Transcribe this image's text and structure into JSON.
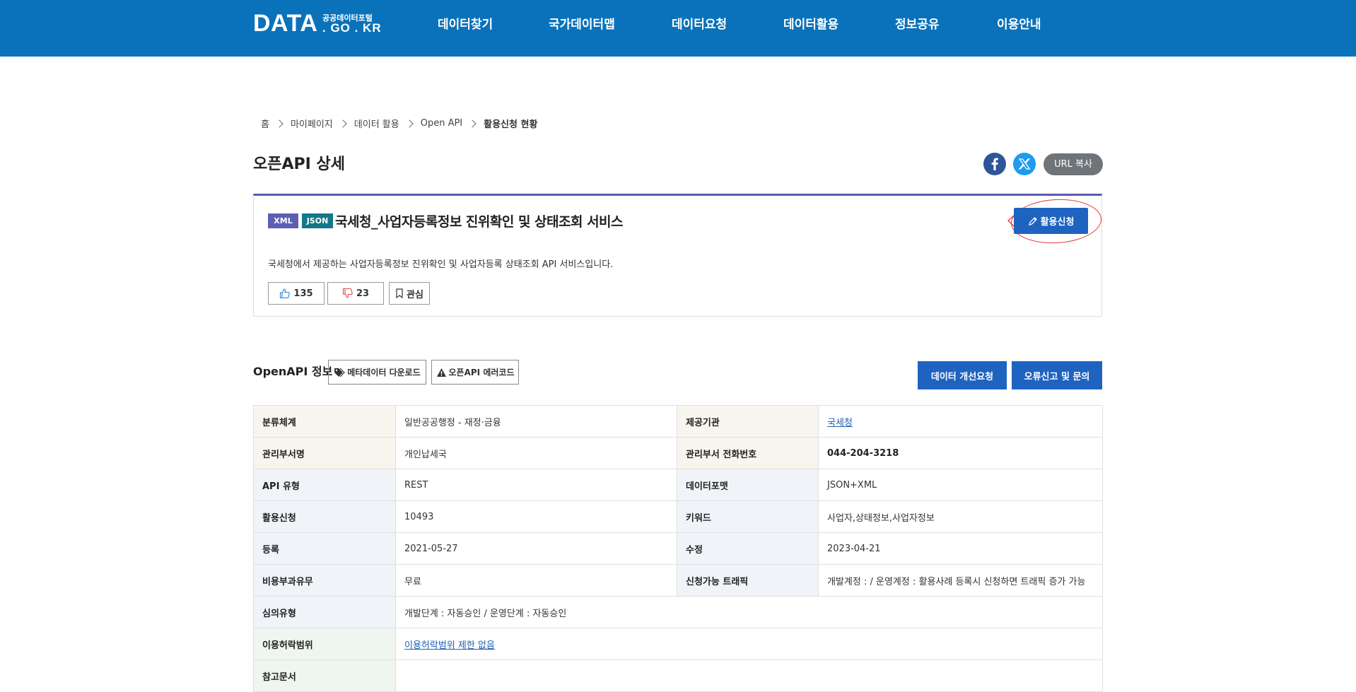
{
  "header": {
    "logo_main": "DATA",
    "logo_sub": "공공데이터포털",
    "logo_domain": ". GO . KR",
    "nav": [
      "데이터찾기",
      "국가데이터맵",
      "데이터요청",
      "데이터활용",
      "정보공유",
      "이용안내"
    ]
  },
  "breadcrumb": [
    "홈",
    "마이페이지",
    "데이터 활용",
    "Open API",
    "활용신청 현황"
  ],
  "page_title": "오픈API 상세",
  "share": {
    "url_copy": "URL 복사",
    "facebook_icon": "facebook-icon",
    "x_icon": "x-twitter-icon"
  },
  "api": {
    "formats": [
      "XML",
      "JSON"
    ],
    "title": "국세청_사업자등록정보 진위확인 및 상태조회 서비스",
    "apply_label": "활용신청",
    "description": "국세청에서 제공하는 사업자등록정보 진위확인 및 사업자등록 상태조회 API 서비스입니다.",
    "likes": "135",
    "dislikes": "23",
    "favorite_label": "관심"
  },
  "info": {
    "title": "OpenAPI 정보",
    "metadata_download": "메타데이터 다운로드",
    "error_code": "오픈API 에러코드",
    "improve_request": "데이터 개선요청",
    "report_inquiry": "오류신고 및 문의",
    "rows": [
      {
        "label1": "분류체계",
        "value1": "일반공공행정 - 재정·금융",
        "label2": "제공기관",
        "value2": "국세청"
      },
      {
        "label1": "관리부서명",
        "value1": "개인납세국",
        "label2": "관리부서 전화번호",
        "value2": "044-204-3218"
      },
      {
        "label1": "API 유형",
        "value1": "REST",
        "label2": "데이터포맷",
        "value2": "JSON+XML"
      },
      {
        "label1": "활용신청",
        "value1": "10493",
        "label2": "키워드",
        "value2": "사업자,상태정보,사업자정보"
      },
      {
        "label1": "등록",
        "value1": "2021-05-27",
        "label2": "수정",
        "value2": "2023-04-21"
      },
      {
        "label1": "비용부과유무",
        "value1": "무료",
        "label2": "신청가능 트래픽",
        "value2": "개발계정 : / 운영계정 : 활용사례 등록시 신청하면 트래픽 증가 가능"
      }
    ],
    "review_label": "심의유형",
    "review_value": "개발단계 : 자동승인 / 운영단계 : 자동승인",
    "license_label": "이용허락범위",
    "license_value": "이용허락범위 제한 없음",
    "reference_label": "참고문서"
  },
  "colors": {
    "header_bg": "#0a72bb",
    "primary_button": "#1f63c0",
    "xml_badge": "#5c5fb4",
    "json_badge": "#13788a",
    "annotation": "#e53935"
  }
}
